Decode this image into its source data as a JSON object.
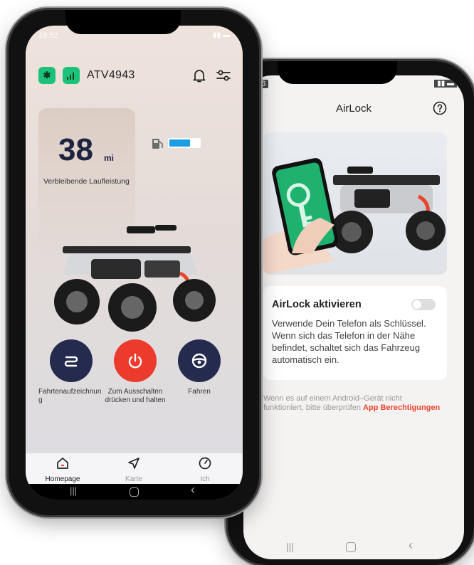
{
  "left_phone": {
    "status": {
      "time": "16:52"
    },
    "header": {
      "device_name": "ATV4943"
    },
    "range": {
      "value": "38",
      "unit": "mi",
      "label": "Verbleibende Laufleistung"
    },
    "battery_fraction": 0.68,
    "controls": [
      {
        "label": "Fahrtenaufzeichnun\ng",
        "icon": "route-icon",
        "color": "#252b4e"
      },
      {
        "label": "Zum Ausschalten\ndrücken und halten",
        "icon": "power-icon",
        "color": "#ec3b2c"
      },
      {
        "label": "Fahren",
        "icon": "steering-wheel-icon",
        "color": "#252b4e"
      }
    ],
    "tabs": [
      {
        "label": "Homepage",
        "icon": "home-icon",
        "active": true
      },
      {
        "label": "Karte",
        "icon": "navigation-icon",
        "active": false
      },
      {
        "label": "Ich",
        "icon": "profile-icon",
        "active": false
      }
    ]
  },
  "right_phone": {
    "status": {
      "time": ":16"
    },
    "title": "AirLock",
    "card": {
      "title": "AirLock aktivieren",
      "description": "Verwende Dein Telefon als Schlüssel. Wenn sich das Telefon in der Nähe befindet, schaltet sich das Fahrzeug automatisch ein.",
      "toggle_on": false
    },
    "hint": {
      "text": "Wenn es auf einem Android–Gerät nicht funktioniert, bitte überprüfen",
      "link": "App Berechtigungen"
    }
  },
  "colors": {
    "accent_green": "#1dc27a",
    "navy": "#252b4e",
    "red": "#ec3b2c",
    "battery_blue": "#1c9ee6",
    "link_red": "#e8452e"
  }
}
